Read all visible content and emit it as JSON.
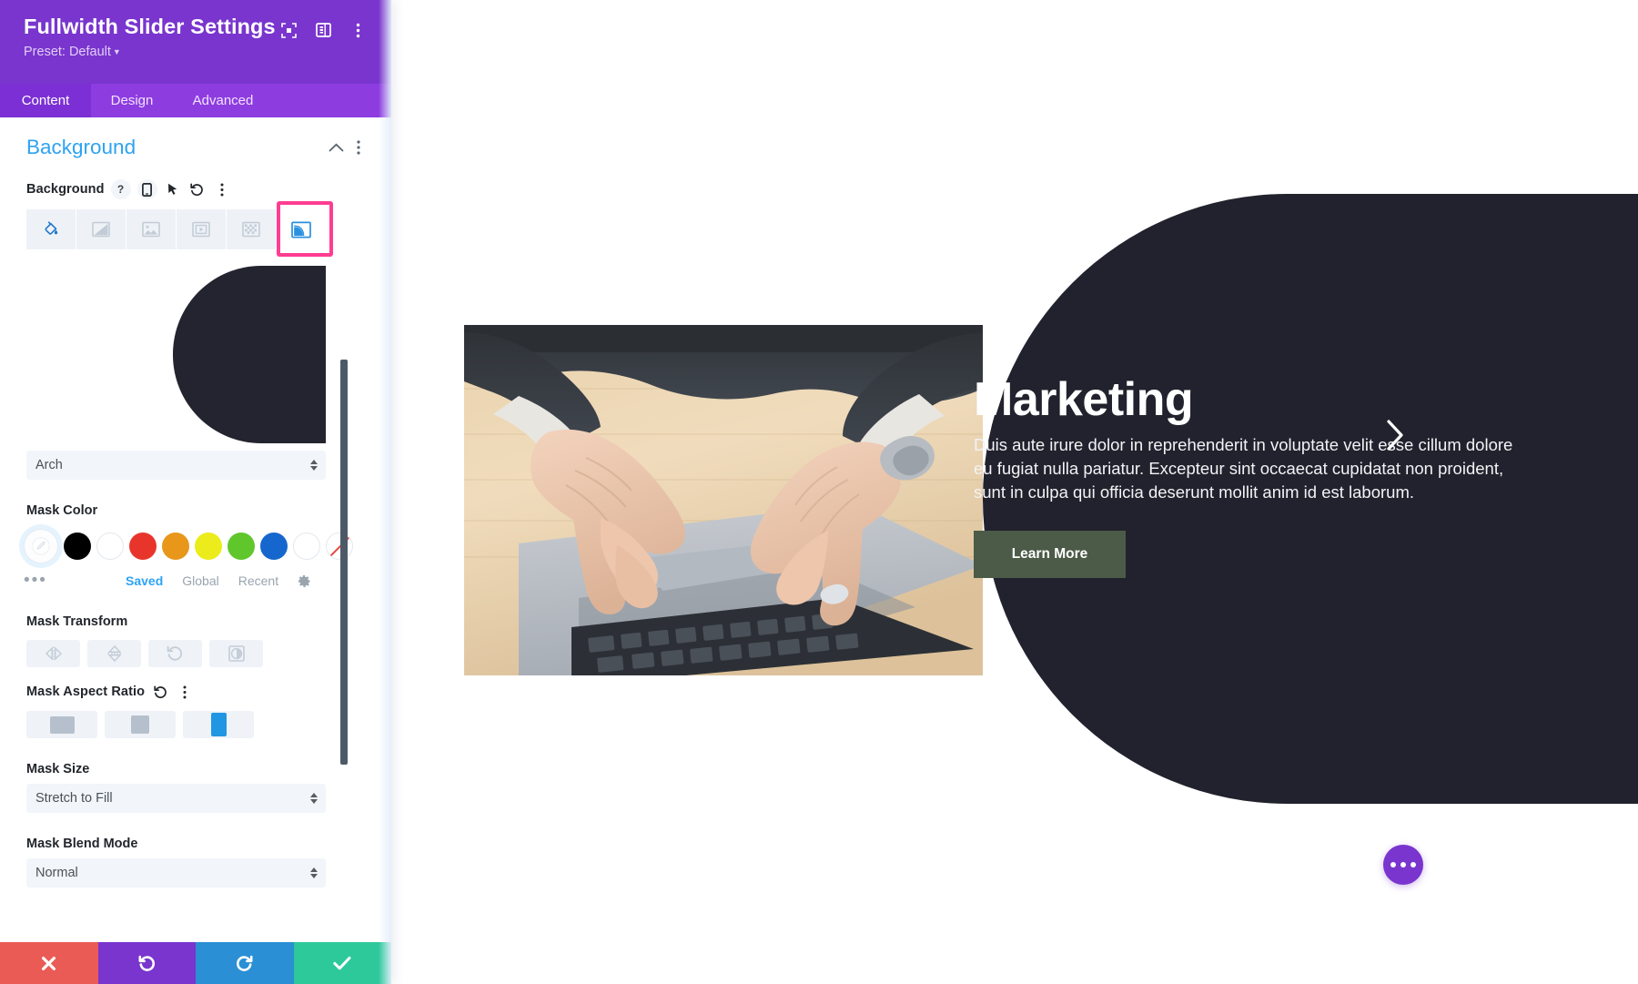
{
  "sidebar": {
    "title": "Fullwidth Slider Settings",
    "preset_label": "Preset: Default",
    "header_icons": [
      {
        "name": "focus-target-icon"
      },
      {
        "name": "layout-panel-icon"
      },
      {
        "name": "kebab-menu-icon"
      }
    ],
    "tabs": [
      {
        "label": "Content",
        "active": true
      },
      {
        "label": "Design",
        "active": false
      },
      {
        "label": "Advanced",
        "active": false
      }
    ],
    "toggle_section": {
      "title": "Background",
      "collapse_icon": "chevron-up-icon",
      "options_icon": "kebab-menu-icon"
    },
    "background_field": {
      "label": "Background",
      "icons": [
        "help-icon",
        "responsive-mobile-icon",
        "hover-cursor-icon",
        "reset-undo-icon",
        "kebab-menu-icon"
      ],
      "types": [
        {
          "name": "background-color",
          "selected": false
        },
        {
          "name": "background-gradient",
          "selected": false
        },
        {
          "name": "background-image",
          "selected": false
        },
        {
          "name": "background-video",
          "selected": false
        },
        {
          "name": "background-pattern",
          "selected": false
        },
        {
          "name": "background-mask",
          "selected": true
        }
      ],
      "highlight_color": "#ff3d91"
    },
    "mask_style": {
      "value": "Arch",
      "preview_color": "#23242f"
    },
    "mask_color": {
      "label": "Mask Color",
      "picker_selected": true,
      "swatches": [
        {
          "name": "black",
          "hex": "#000000"
        },
        {
          "name": "white",
          "hex": "#ffffff"
        },
        {
          "name": "red",
          "hex": "#e8352c"
        },
        {
          "name": "orange",
          "hex": "#e8971a"
        },
        {
          "name": "yellow",
          "hex": "#ecec1c"
        },
        {
          "name": "green",
          "hex": "#5fc62c"
        },
        {
          "name": "blue",
          "hex": "#1667cd"
        },
        {
          "name": "white-outline",
          "hex": "#ffffff"
        },
        {
          "name": "transparent",
          "hex": "none"
        }
      ],
      "more_label": "•••",
      "tabs": [
        {
          "label": "Saved",
          "active": true
        },
        {
          "label": "Global",
          "active": false
        },
        {
          "label": "Recent",
          "active": false
        }
      ],
      "settings_icon": "gear-icon"
    },
    "mask_transform": {
      "label": "Mask Transform",
      "buttons": [
        {
          "name": "flip-horizontal-icon"
        },
        {
          "name": "flip-vertical-icon"
        },
        {
          "name": "rotate-icon"
        },
        {
          "name": "invert-icon"
        }
      ]
    },
    "mask_aspect_ratio": {
      "label": "Mask Aspect Ratio",
      "reset_icon": "reset-undo-icon",
      "options_icon": "kebab-menu-icon",
      "options": [
        {
          "name": "landscape",
          "selected": false
        },
        {
          "name": "square",
          "selected": false
        },
        {
          "name": "portrait",
          "selected": true
        }
      ],
      "selected_color": "#2196e3"
    },
    "mask_size": {
      "label": "Mask Size",
      "value": "Stretch to Fill"
    },
    "mask_blend_mode": {
      "label": "Mask Blend Mode",
      "value": "Normal"
    },
    "footer": [
      {
        "name": "cancel-button",
        "icon": "close-x-icon",
        "color": "#eb5b55"
      },
      {
        "name": "undo-button",
        "icon": "undo-icon",
        "color": "#7935ce"
      },
      {
        "name": "redo-button",
        "icon": "redo-icon",
        "color": "#2a8fd4"
      },
      {
        "name": "save-button",
        "icon": "check-icon",
        "color": "#2dc99a"
      }
    ],
    "scrollbar": {
      "name": "vertical-scrollbar"
    }
  },
  "canvas": {
    "slide": {
      "title": "Marketing",
      "description": "Duis aute irure dolor in reprehenderit in voluptate velit esse cillum dolore eu fugiat nulla pariatur. Excepteur sint occaecat cupidatat non proident, sunt in culpa qui officia deserunt mollit anim id est laborum.",
      "button_label": "Learn More",
      "button_color": "#4c5a48",
      "mask_color": "#21222d",
      "next_arrow_icon": "chevron-right-icon",
      "image_alt": "hands-typing-on-laptop"
    },
    "fab": {
      "name": "page-settings-fab",
      "icon": "ellipsis-icon",
      "color": "#7935ce"
    }
  }
}
